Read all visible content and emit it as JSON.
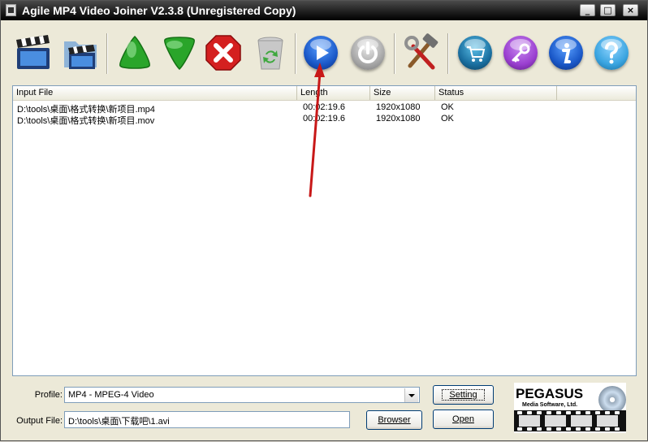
{
  "window": {
    "title": "Agile MP4 Video Joiner V2.3.8 (Unregistered Copy)",
    "controls": {
      "minimize": "_",
      "maximize": "□",
      "close": "×"
    }
  },
  "toolbar": {
    "tools": [
      {
        "id": "add-file",
        "icon": "clapperboard-add-icon"
      },
      {
        "id": "add-folder",
        "icon": "folder-clapperboard-icon"
      },
      {
        "id": "move-up",
        "icon": "green-up-arrow-icon"
      },
      {
        "id": "move-down",
        "icon": "green-down-arrow-icon"
      },
      {
        "id": "remove",
        "icon": "red-x-icon"
      },
      {
        "id": "clear",
        "icon": "recycle-bin-icon"
      },
      {
        "id": "start",
        "icon": "blue-play-icon"
      },
      {
        "id": "stop",
        "icon": "power-icon"
      },
      {
        "id": "settings",
        "icon": "hammer-wrench-icon"
      },
      {
        "id": "buy",
        "icon": "cart-icon"
      },
      {
        "id": "register",
        "icon": "key-icon"
      },
      {
        "id": "about",
        "icon": "info-icon"
      },
      {
        "id": "help",
        "icon": "question-icon"
      }
    ],
    "colors": {
      "green": "#2aa52a",
      "red": "#d42020",
      "blue": "#1a58c8",
      "purple": "#9a3fd0",
      "teal": "#1a6fa0",
      "cyan": "#3aa4e0",
      "gray": "#a8a8a8"
    }
  },
  "file_list": {
    "columns": [
      "Input File",
      "Length",
      "Size",
      "Status"
    ],
    "rows": [
      {
        "file": "D:\\tools\\桌面\\格式转换\\新项目.mp4",
        "length": "00:02:19.6",
        "size": "1920x1080",
        "status": "OK"
      },
      {
        "file": "D:\\tools\\桌面\\格式转换\\新项目.mov",
        "length": "00:02:19.6",
        "size": "1920x1080",
        "status": "OK"
      }
    ]
  },
  "form": {
    "profile_label": "Profile:",
    "profile_value": "MP4 - MPEG-4 Video",
    "output_label": "Output File:",
    "output_value": "D:\\tools\\桌面\\下载吧\\1.avi",
    "setting_button": "Setting",
    "browser_button": "Browser",
    "open_button": "Open"
  },
  "logo": {
    "brand": "PEGASUS",
    "subtitle": "Media Software, Ltd."
  },
  "annotation": {
    "arrow_color": "#d42020"
  }
}
